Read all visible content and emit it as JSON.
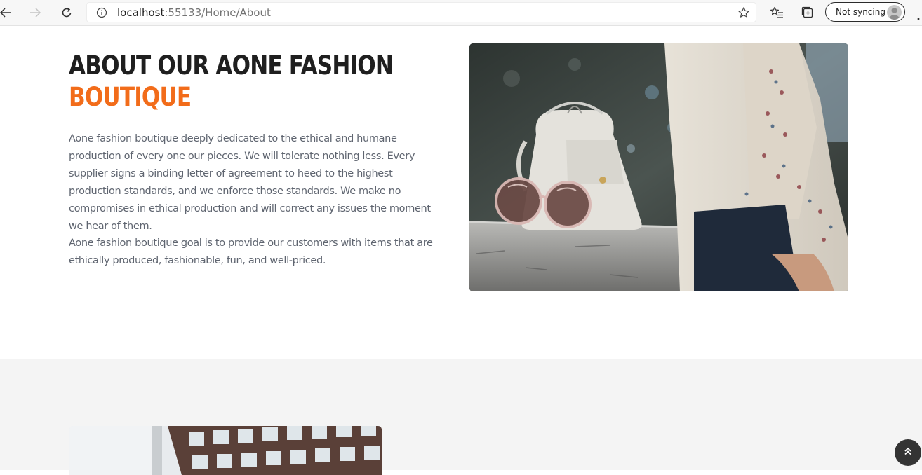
{
  "browser": {
    "url_host": "localhost",
    "url_rest": ":55133/Home/About",
    "sync_label": "Not syncing"
  },
  "about": {
    "heading_line1": "ABOUT OUR AONE FASHION",
    "heading_line2": "BOUTIQUE",
    "paragraph1": "Aone fashion boutique deeply dedicated to the ethical and humane production of every one our pieces. We will tolerate nothing less. Every supplier signs a binding letter of agreement to heed to the highest production standards, and we enforce those standards. We make no compromises in ethical production and will correct any issues the moment we hear of them.",
    "paragraph2": "Aone fashion boutique goal is to provide our customers with items that are ethically produced, fashionable, fun, and well-priced."
  },
  "icons": {
    "back": "back-arrow-icon",
    "forward": "forward-arrow-icon",
    "reload": "reload-icon",
    "info": "info-icon",
    "favorite": "star-icon",
    "favorites_list": "favorites-list-icon",
    "collections": "collections-icon",
    "profile": "avatar",
    "menu": "more-icon",
    "back_to_top": "double-chevron-up-icon"
  },
  "colors": {
    "accent": "#f26c1a",
    "heading": "#1f1f1f",
    "body_text": "#5f6570",
    "section_bg": "#f4f4f4",
    "back_to_top_bg": "#333333"
  }
}
